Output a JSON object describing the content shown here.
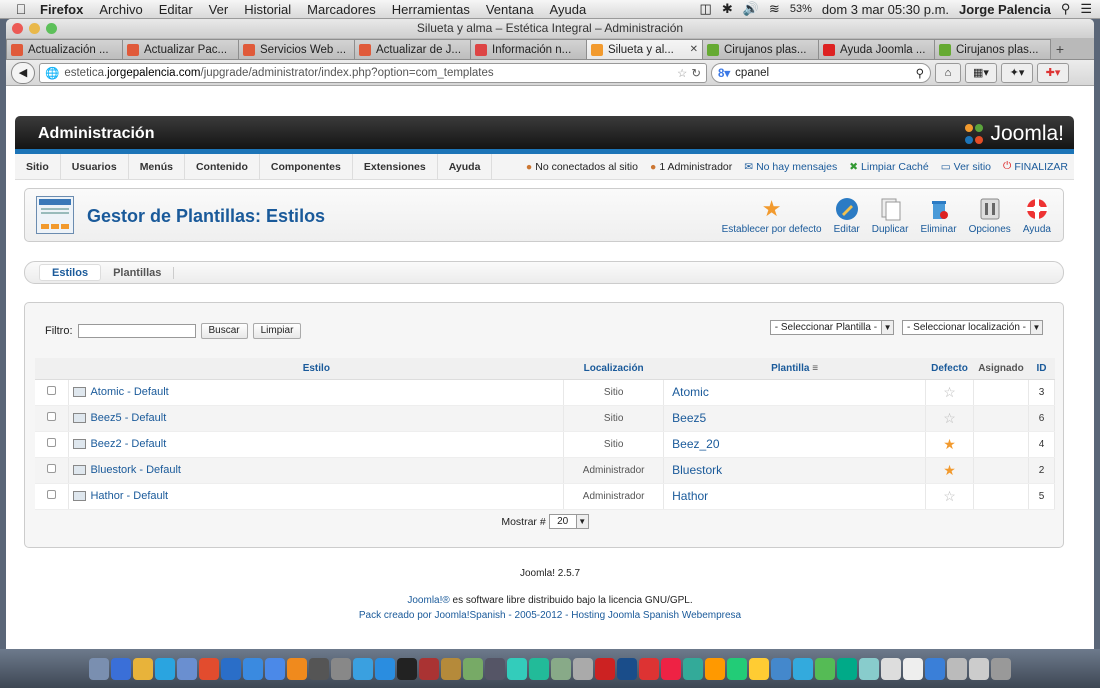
{
  "macos": {
    "app": "Firefox",
    "menus": [
      "Archivo",
      "Editar",
      "Ver",
      "Historial",
      "Marcadores",
      "Herramientas",
      "Ventana",
      "Ayuda"
    ],
    "battery": "53%",
    "datetime": "dom 3 mar  05:30 p.m.",
    "user": "Jorge Palencia"
  },
  "window": {
    "title": "Silueta y alma – Estética Integral – Administración"
  },
  "tabs": [
    {
      "label": "Actualización ...",
      "icon": "w-icon",
      "color": "#e05a3a"
    },
    {
      "label": "Actualizar Pac...",
      "icon": "w-icon",
      "color": "#e05a3a"
    },
    {
      "label": "Servicios Web ...",
      "icon": "w-icon",
      "color": "#e05a3a"
    },
    {
      "label": "Actualizar de J...",
      "icon": "w-icon",
      "color": "#e05a3a"
    },
    {
      "label": "Información n...",
      "icon": "gmail-icon",
      "color": "#d44"
    },
    {
      "label": "Silueta y al...",
      "icon": "joomla-icon",
      "color": "#f29a2e",
      "active": true
    },
    {
      "label": "Cirujanos plas...",
      "icon": "cirujanos-icon",
      "color": "#6a3"
    },
    {
      "label": "Ayuda Joomla ...",
      "icon": "youtube-icon",
      "color": "#d22"
    },
    {
      "label": "Cirujanos plas...",
      "icon": "cirujanos-icon",
      "color": "#6a3"
    }
  ],
  "nav": {
    "url_prefix": "estetica.",
    "url_domain": "jorgepalencia.com",
    "url_path": "/jupgrade/administrator/index.php?option=com_templates",
    "search": "cpanel"
  },
  "joomla": {
    "header_title": "Administración",
    "logo_text": "Joomla!",
    "menu": [
      "Sitio",
      "Usuarios",
      "Menús",
      "Contenido",
      "Componentes",
      "Extensiones",
      "Ayuda"
    ],
    "status": {
      "not_connected": "No conectados al sitio",
      "admins": "1 Administrador",
      "messages": "No hay mensajes",
      "clear_cache": "Limpiar Caché",
      "view_site": "Ver sitio",
      "logout": "FINALIZAR"
    },
    "page_title": "Gestor de Plantillas: Estilos",
    "toolbar": {
      "default": "Establecer por defecto",
      "edit": "Editar",
      "duplicate": "Duplicar",
      "delete": "Eliminar",
      "options": "Opciones",
      "help": "Ayuda"
    },
    "subtabs": [
      "Estilos",
      "Plantillas"
    ],
    "filter": {
      "label": "Filtro:",
      "value": "",
      "search": "Buscar",
      "clear": "Limpiar",
      "select_template": "- Seleccionar Plantilla -",
      "select_location": "- Seleccionar localización -"
    },
    "columns": {
      "style": "Estilo",
      "location": "Localización",
      "template": "Plantilla",
      "default": "Defecto",
      "assigned": "Asignado",
      "id": "ID"
    },
    "rows": [
      {
        "style": "Atomic - Default",
        "location": "Sitio",
        "template": "Atomic",
        "default": false,
        "id": "3"
      },
      {
        "style": "Beez5 - Default",
        "location": "Sitio",
        "template": "Beez5",
        "default": false,
        "id": "6"
      },
      {
        "style": "Beez2 - Default",
        "location": "Sitio",
        "template": "Beez_20",
        "default": true,
        "id": "4"
      },
      {
        "style": "Bluestork - Default",
        "location": "Administrador",
        "template": "Bluestork",
        "default": true,
        "id": "2"
      },
      {
        "style": "Hathor - Default",
        "location": "Administrador",
        "template": "Hathor",
        "default": false,
        "id": "5"
      }
    ],
    "pager": {
      "label": "Mostrar #",
      "value": "20"
    },
    "footer": {
      "version": "Joomla! 2.5.7",
      "license_link": "Joomla!®",
      "license_text": " es software libre distribuido bajo la licencia GNU/GPL.",
      "credits": "Pack creado por Joomla!Spanish - 2005-2012 - Hosting Joomla Spanish Webempresa"
    }
  }
}
